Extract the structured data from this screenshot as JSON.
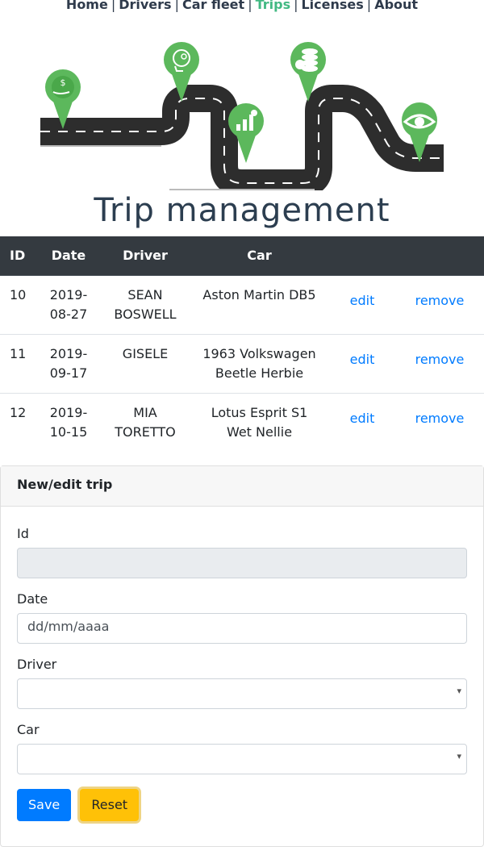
{
  "nav": {
    "items": [
      {
        "label": "Home"
      },
      {
        "label": "Drivers"
      },
      {
        "label": "Car fleet"
      },
      {
        "label": "Trips"
      },
      {
        "label": "Licenses"
      },
      {
        "label": "About"
      }
    ],
    "separator": "|",
    "active": "Trips"
  },
  "colors": {
    "nav_active": "#42b983",
    "table_header": "#343a40",
    "link": "#007bff",
    "primary": "#007bff",
    "warning": "#ffc107",
    "banner_pin": "#5cb85c",
    "road": "#2d2d2d"
  },
  "banner": {
    "icons": [
      "money-hand-icon",
      "brain-gears-icon",
      "growth-chart-icon",
      "coins-icon",
      "eye-icon"
    ]
  },
  "page_title": "Trip management",
  "table": {
    "headers": [
      "ID",
      "Date",
      "Driver",
      "Car",
      "",
      ""
    ],
    "rows": [
      {
        "id": "10",
        "date": "2019-08-27",
        "driver": "SEAN BOSWELL",
        "car": "Aston Martin DB5",
        "edit": "edit",
        "remove": "remove"
      },
      {
        "id": "11",
        "date": "2019-09-17",
        "driver": "GISELE",
        "car": "1963 Volkswagen Beetle Herbie",
        "edit": "edit",
        "remove": "remove"
      },
      {
        "id": "12",
        "date": "2019-10-15",
        "driver": "MIA TORETTO",
        "car": "Lotus Esprit S1 Wet Nellie",
        "edit": "edit",
        "remove": "remove"
      }
    ]
  },
  "form": {
    "title": "New/edit trip",
    "id_label": "Id",
    "id_value": "",
    "date_label": "Date",
    "date_placeholder": "dd/mm/aaaa",
    "driver_label": "Driver",
    "driver_value": "",
    "car_label": "Car",
    "car_value": "",
    "save_label": "Save",
    "reset_label": "Reset"
  }
}
